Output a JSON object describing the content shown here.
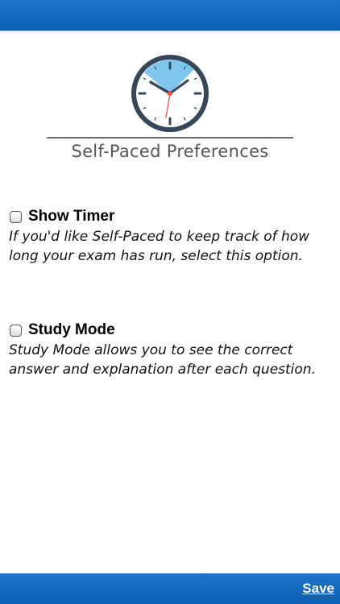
{
  "header": {
    "bar_color": "#0a5fb4"
  },
  "brand": {
    "icon": "clock-icon",
    "title": "Self-Paced Preferences",
    "clock_highlight_color": "#7fc6ee",
    "clock_ring_color": "#36475a",
    "clock_second_hand_color": "#e8524a"
  },
  "options": [
    {
      "label": "Show Timer",
      "checked": false,
      "description": "If you'd like Self-Paced to keep track of how long your exam has run, select this option."
    },
    {
      "label": "Study Mode",
      "checked": false,
      "description": "Study Mode allows you to see the correct answer and explanation after each question."
    }
  ],
  "footer": {
    "save_label": "Save"
  }
}
